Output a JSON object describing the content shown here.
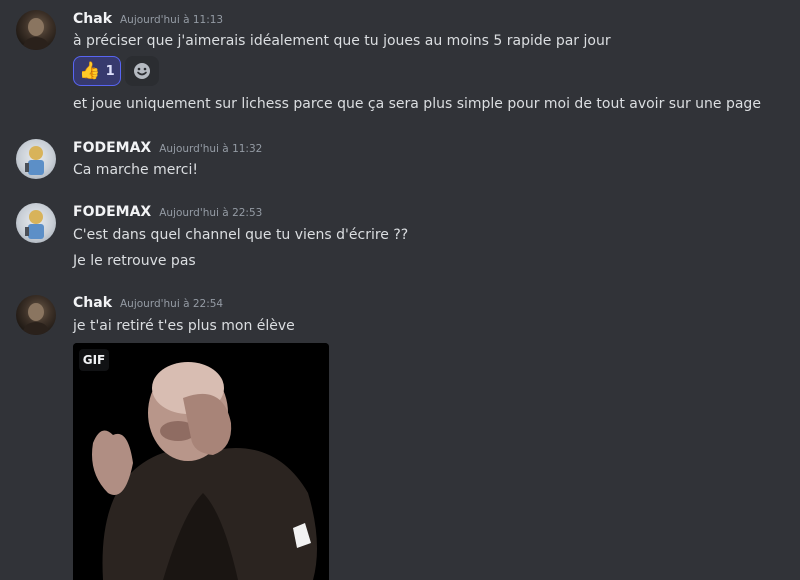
{
  "messages": [
    {
      "author": "Chak",
      "timestamp": "Aujourd'hui à 11:13",
      "lines": [
        "à préciser que j'aimerais idéalement que tu joues au moins 5 rapide par jour",
        "et joue uniquement sur lichess parce que ça sera plus simple pour moi de tout avoir sur une page"
      ],
      "reactions": [
        {
          "emoji": "👍",
          "count": "1",
          "icon": "thumbs-up-icon"
        }
      ],
      "add_reaction_icon": "add-reaction-icon"
    },
    {
      "author": "FODEMAX",
      "timestamp": "Aujourd'hui à 11:32",
      "lines": [
        "Ca marche merci!"
      ]
    },
    {
      "author": "FODEMAX",
      "timestamp": "Aujourd'hui à 22:53",
      "lines": [
        "C'est dans quel channel que tu viens d'écrire ??",
        "Je le retrouve pas"
      ]
    },
    {
      "author": "Chak",
      "timestamp": "Aujourd'hui à 22:54",
      "lines": [
        "je t'ai retiré t'es plus mon élève"
      ],
      "attachment": {
        "type": "gif",
        "badge": "GIF"
      }
    }
  ],
  "colors": {
    "background": "#313338",
    "username": "#f2f3f5",
    "timestamp": "#949ba4",
    "text": "#dbdee1",
    "reaction_active_border": "#5865f2"
  }
}
